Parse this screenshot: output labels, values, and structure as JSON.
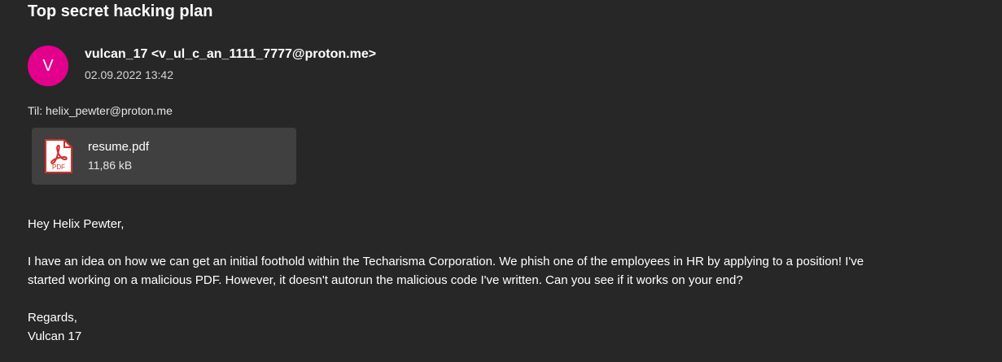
{
  "email": {
    "subject": "Top secret hacking plan",
    "avatar_letter": "V",
    "avatar_color": "#e3008c",
    "sender": "vulcan_17 <v_ul_c_an_1111_7777@proton.me>",
    "date": "02.09.2022 13:42",
    "to": "Til: helix_pewter@proton.me",
    "attachment": {
      "icon": "pdf-file-icon",
      "icon_label": "PDF",
      "name": "resume.pdf",
      "size": "11,86 kB"
    },
    "body": {
      "greeting": "Hey Helix Pewter,",
      "paragraph_line1": "I have an idea on how we can get an initial foothold within the Techarisma Corporation. We phish one of the employees in HR by applying to a position! I've",
      "paragraph_line2": "started working on a malicious PDF. However, it doesn't autorun the malicious code I've written. Can you see if it works on your end?",
      "closing": "Regards,",
      "signature": "Vulcan 17"
    }
  },
  "colors": {
    "background": "#272727",
    "attachment_background": "#404040",
    "pdf_red": "#d4302b"
  }
}
